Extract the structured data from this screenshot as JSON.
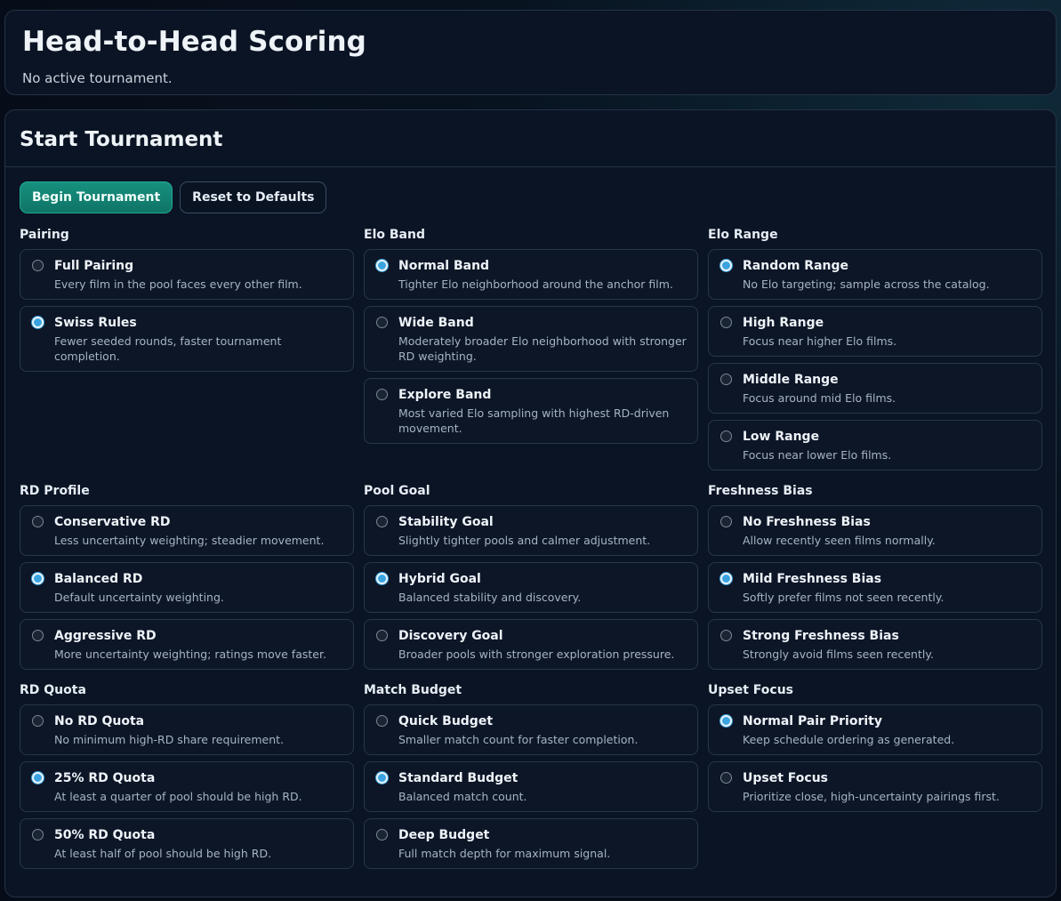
{
  "header": {
    "title": "Head-to-Head Scoring",
    "subtitle": "No active tournament."
  },
  "panel": {
    "title": "Start Tournament",
    "begin_label": "Begin Tournament",
    "reset_label": "Reset to Defaults"
  },
  "groups": [
    {
      "title": "Pairing",
      "options": [
        {
          "name": "Full Pairing",
          "desc": "Every film in the pool faces every other film.",
          "selected": false
        },
        {
          "name": "Swiss Rules",
          "desc": "Fewer seeded rounds, faster tournament completion.",
          "selected": true
        }
      ]
    },
    {
      "title": "Elo Band",
      "options": [
        {
          "name": "Normal Band",
          "desc": "Tighter Elo neighborhood around the anchor film.",
          "selected": true
        },
        {
          "name": "Wide Band",
          "desc": "Moderately broader Elo neighborhood with stronger RD weighting.",
          "selected": false
        },
        {
          "name": "Explore Band",
          "desc": "Most varied Elo sampling with highest RD-driven movement.",
          "selected": false
        }
      ]
    },
    {
      "title": "Elo Range",
      "options": [
        {
          "name": "Random Range",
          "desc": "No Elo targeting; sample across the catalog.",
          "selected": true
        },
        {
          "name": "High Range",
          "desc": "Focus near higher Elo films.",
          "selected": false
        },
        {
          "name": "Middle Range",
          "desc": "Focus around mid Elo films.",
          "selected": false
        },
        {
          "name": "Low Range",
          "desc": "Focus near lower Elo films.",
          "selected": false
        }
      ]
    },
    {
      "title": "RD Profile",
      "options": [
        {
          "name": "Conservative RD",
          "desc": "Less uncertainty weighting; steadier movement.",
          "selected": false
        },
        {
          "name": "Balanced RD",
          "desc": "Default uncertainty weighting.",
          "selected": true
        },
        {
          "name": "Aggressive RD",
          "desc": "More uncertainty weighting; ratings move faster.",
          "selected": false
        }
      ]
    },
    {
      "title": "Pool Goal",
      "options": [
        {
          "name": "Stability Goal",
          "desc": "Slightly tighter pools and calmer adjustment.",
          "selected": false
        },
        {
          "name": "Hybrid Goal",
          "desc": "Balanced stability and discovery.",
          "selected": true
        },
        {
          "name": "Discovery Goal",
          "desc": "Broader pools with stronger exploration pressure.",
          "selected": false
        }
      ]
    },
    {
      "title": "Freshness Bias",
      "options": [
        {
          "name": "No Freshness Bias",
          "desc": "Allow recently seen films normally.",
          "selected": false
        },
        {
          "name": "Mild Freshness Bias",
          "desc": "Softly prefer films not seen recently.",
          "selected": true
        },
        {
          "name": "Strong Freshness Bias",
          "desc": "Strongly avoid films seen recently.",
          "selected": false
        }
      ]
    },
    {
      "title": "RD Quota",
      "options": [
        {
          "name": "No RD Quota",
          "desc": "No minimum high-RD share requirement.",
          "selected": false
        },
        {
          "name": "25% RD Quota",
          "desc": "At least a quarter of pool should be high RD.",
          "selected": true
        },
        {
          "name": "50% RD Quota",
          "desc": "At least half of pool should be high RD.",
          "selected": false
        }
      ]
    },
    {
      "title": "Match Budget",
      "options": [
        {
          "name": "Quick Budget",
          "desc": "Smaller match count for faster completion.",
          "selected": false
        },
        {
          "name": "Standard Budget",
          "desc": "Balanced match count.",
          "selected": true
        },
        {
          "name": "Deep Budget",
          "desc": "Full match depth for maximum signal.",
          "selected": false
        }
      ]
    },
    {
      "title": "Upset Focus",
      "options": [
        {
          "name": "Normal Pair Priority",
          "desc": "Keep schedule ordering as generated.",
          "selected": true
        },
        {
          "name": "Upset Focus",
          "desc": "Prioritize close, high-uncertainty pairings first.",
          "selected": false
        }
      ]
    }
  ]
}
